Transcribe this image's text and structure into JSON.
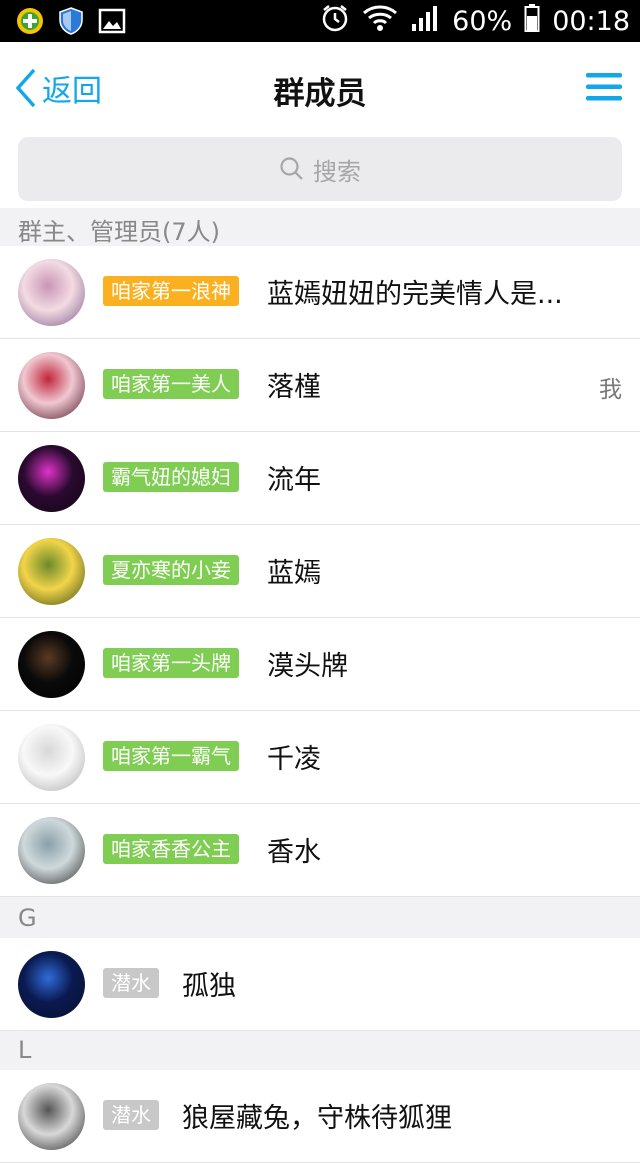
{
  "status_bar": {
    "battery": "60%",
    "time": "00:18"
  },
  "nav": {
    "back_label": "返回",
    "title": "群成员"
  },
  "search": {
    "placeholder": "搜索"
  },
  "sections": [
    {
      "header": "群主、管理员(7人)"
    },
    {
      "header": "G"
    },
    {
      "header": "L"
    }
  ],
  "admins": [
    {
      "badge": "咱家第一浪神",
      "badge_color": "#fbb020",
      "name": "蓝嫣妞妞的完美情人是...",
      "avatar_colors": [
        "#f3dbe2",
        "#c995b8",
        "#7d5a88"
      ]
    },
    {
      "badge": "咱家第一美人",
      "badge_color": "#7fcd52",
      "name": "落槿",
      "tag": "我",
      "avatar_colors": [
        "#f0c8d2",
        "#c0253a",
        "#4a1020"
      ]
    },
    {
      "badge": "霸气妞的媳妇",
      "badge_color": "#7fcd52",
      "name": "流年",
      "avatar_colors": [
        "#2a0a30",
        "#e033c8",
        "#120512"
      ]
    },
    {
      "badge": "夏亦寒的小妾",
      "badge_color": "#7fcd52",
      "name": "蓝嫣",
      "avatar_colors": [
        "#f2d44a",
        "#6b8a2a",
        "#3a4a12"
      ]
    },
    {
      "badge": "咱家第一头牌",
      "badge_color": "#7fcd52",
      "name": "漠头牌",
      "avatar_colors": [
        "#0a0a0a",
        "#5a3a22",
        "#000000"
      ]
    },
    {
      "badge": "咱家第一霸气",
      "badge_color": "#7fcd52",
      "name": "千凌",
      "avatar_colors": [
        "#f8f8f8",
        "#d8d8d8",
        "#aaaaaa"
      ]
    },
    {
      "badge": "咱家香香公主",
      "badge_color": "#7fcd52",
      "name": "香水",
      "avatar_colors": [
        "#cfd9dc",
        "#8aa0a8",
        "#2a2a2a"
      ]
    }
  ],
  "g_members": [
    {
      "badge": "潜水",
      "badge_color": "#c8c8c8",
      "name": "孤独",
      "avatar_colors": [
        "#0a1a50",
        "#2f6cd8",
        "#081030"
      ]
    }
  ],
  "l_members": [
    {
      "badge": "潜水",
      "badge_color": "#c8c8c8",
      "name": "狼屋藏兔，守株待狐狸",
      "avatar_colors": [
        "#d8d8d8",
        "#555555",
        "#222222"
      ]
    }
  ]
}
